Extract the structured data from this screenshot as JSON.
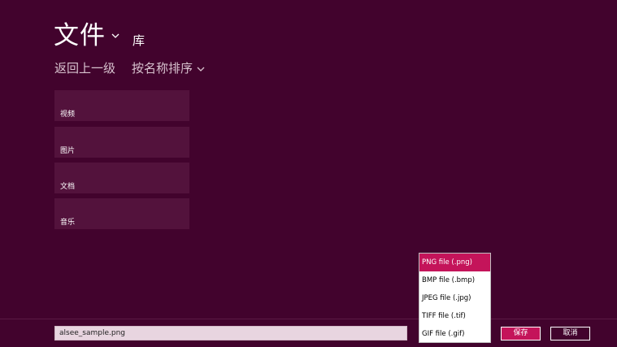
{
  "header": {
    "title": "文件",
    "location": "库"
  },
  "nav": {
    "up_label": "返回上一级",
    "sort_label": "按名称排序"
  },
  "folders": [
    {
      "label": "视频"
    },
    {
      "label": "图片"
    },
    {
      "label": "文档"
    },
    {
      "label": "音乐"
    }
  ],
  "save_bar": {
    "filename": "alsee_sample.png",
    "save_label": "保存",
    "cancel_label": "取消"
  },
  "file_type_options": [
    {
      "label": "PNG file (.png)",
      "selected": true
    },
    {
      "label": "BMP file (.bmp)",
      "selected": false
    },
    {
      "label": "JPEG file (.jpg)",
      "selected": false
    },
    {
      "label": "TIFF file (.tif)",
      "selected": false
    },
    {
      "label": "GIF file (.gif)",
      "selected": false
    }
  ],
  "colors": {
    "background": "#42032d",
    "tile": "#53123c",
    "accent": "#c4145a"
  },
  "icons": {
    "title_chevron": "chevron-down-icon",
    "sort_chevron": "chevron-down-icon"
  }
}
